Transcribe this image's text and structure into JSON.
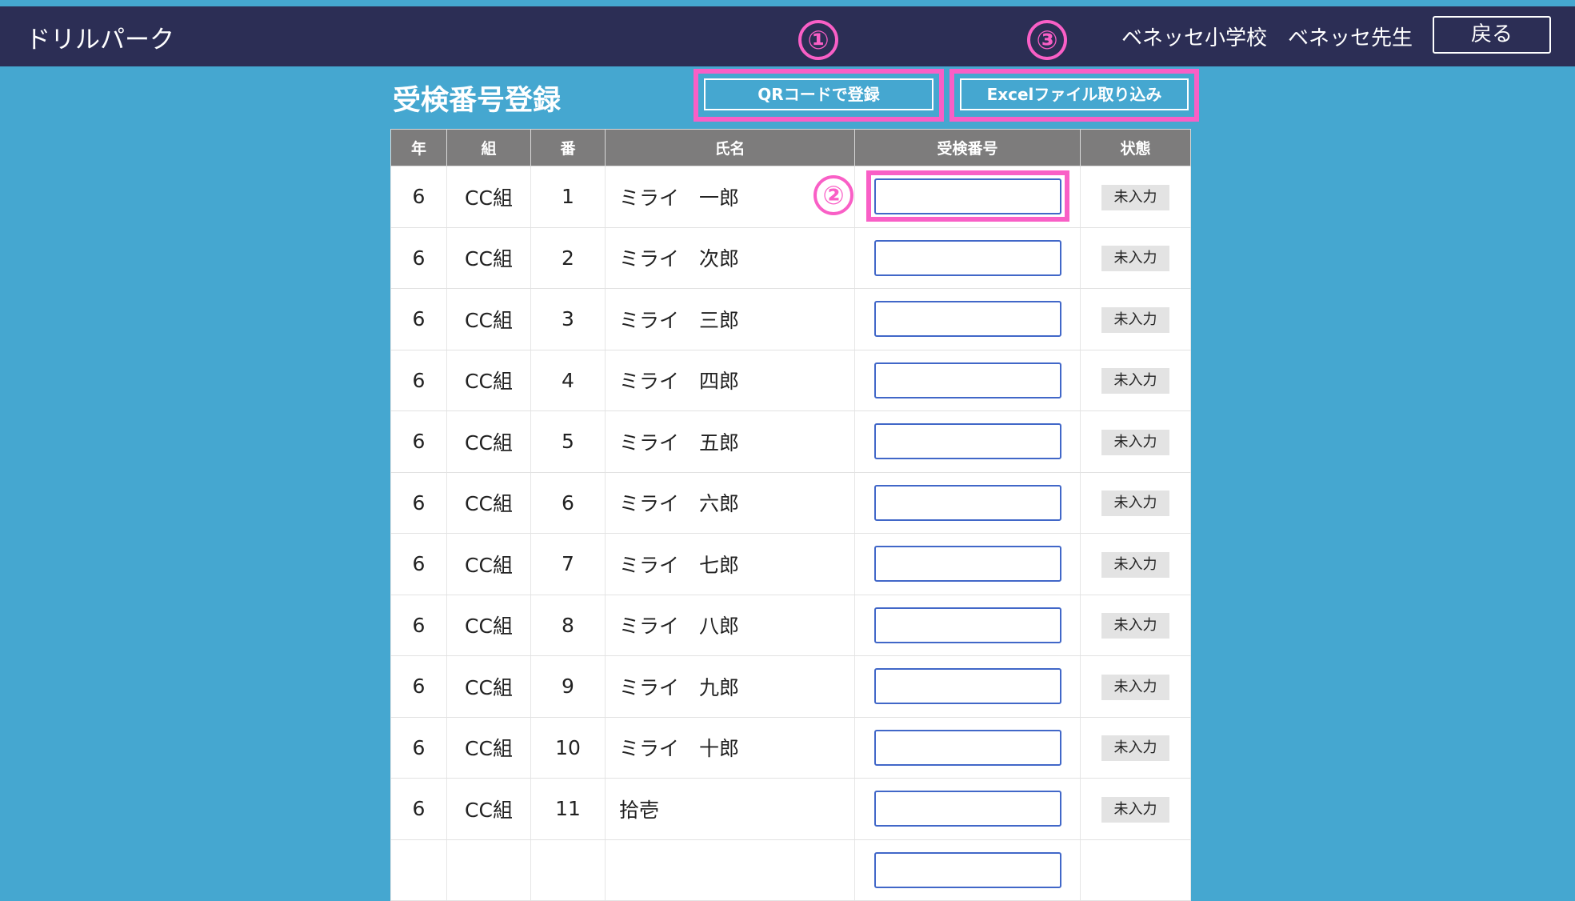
{
  "header": {
    "app_title": "ドリルパーク",
    "school": "ベネッセ小学校",
    "teacher": "ベネッセ先生",
    "back_label": "戻る"
  },
  "page": {
    "title": "受検番号登録",
    "qr_button": "QRコードで登録",
    "excel_button": "Excelファイル取り込み"
  },
  "markers": {
    "one": "①",
    "two": "②",
    "three": "③"
  },
  "table": {
    "columns": [
      "年",
      "組",
      "番",
      "氏名",
      "受検番号",
      "状態"
    ],
    "rows": [
      {
        "grade": "6",
        "class": "CC組",
        "num": "1",
        "name": "ミライ　一郎",
        "exam_no": "",
        "status": "未入力"
      },
      {
        "grade": "6",
        "class": "CC組",
        "num": "2",
        "name": "ミライ　次郎",
        "exam_no": "",
        "status": "未入力"
      },
      {
        "grade": "6",
        "class": "CC組",
        "num": "3",
        "name": "ミライ　三郎",
        "exam_no": "",
        "status": "未入力"
      },
      {
        "grade": "6",
        "class": "CC組",
        "num": "4",
        "name": "ミライ　四郎",
        "exam_no": "",
        "status": "未入力"
      },
      {
        "grade": "6",
        "class": "CC組",
        "num": "5",
        "name": "ミライ　五郎",
        "exam_no": "",
        "status": "未入力"
      },
      {
        "grade": "6",
        "class": "CC組",
        "num": "6",
        "name": "ミライ　六郎",
        "exam_no": "",
        "status": "未入力"
      },
      {
        "grade": "6",
        "class": "CC組",
        "num": "7",
        "name": "ミライ　七郎",
        "exam_no": "",
        "status": "未入力"
      },
      {
        "grade": "6",
        "class": "CC組",
        "num": "8",
        "name": "ミライ　八郎",
        "exam_no": "",
        "status": "未入力"
      },
      {
        "grade": "6",
        "class": "CC組",
        "num": "9",
        "name": "ミライ　九郎",
        "exam_no": "",
        "status": "未入力"
      },
      {
        "grade": "6",
        "class": "CC組",
        "num": "10",
        "name": "ミライ　十郎",
        "exam_no": "",
        "status": "未入力"
      },
      {
        "grade": "6",
        "class": "CC組",
        "num": "11",
        "name": "拾壱",
        "exam_no": "",
        "status": "未入力"
      },
      {
        "grade": "",
        "class": "",
        "num": "",
        "name": "",
        "exam_no": "",
        "status": ""
      }
    ]
  },
  "colors": {
    "highlight": "#f95fc6",
    "header_bg": "#2c2e55",
    "page_bg": "#45a7d0"
  }
}
